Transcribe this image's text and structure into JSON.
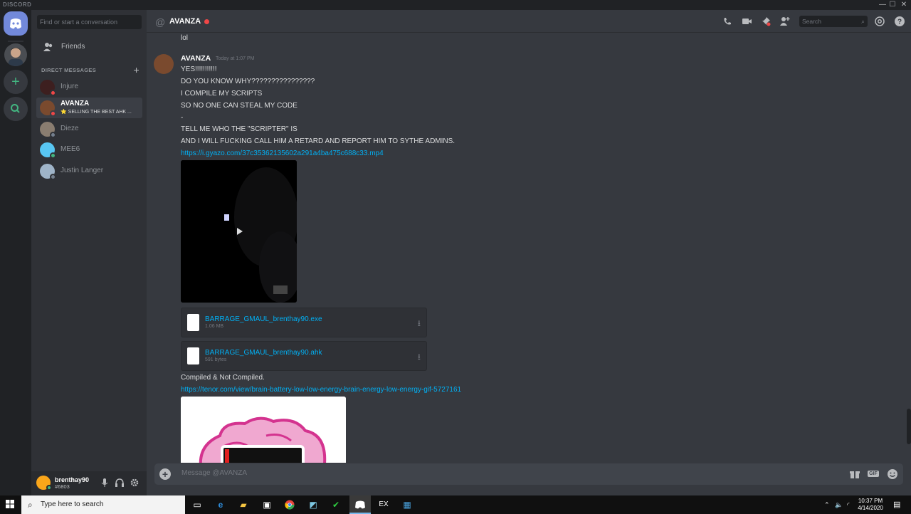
{
  "app": {
    "brand": "DISCORD"
  },
  "window_controls": {
    "minimize": "—",
    "maximize": "☐",
    "close": "✕"
  },
  "sidebar": {
    "search_placeholder": "Find or start a conversation",
    "friends_label": "Friends",
    "dm_header": "DIRECT MESSAGES",
    "dm_add": "+",
    "dms": [
      {
        "name": "Injure",
        "status": "dnd",
        "status_color": "#f04747"
      },
      {
        "name": "AVANZA",
        "sub": "⭐ SELLING THE BEST AHK ...",
        "status": "dnd",
        "status_color": "#f04747",
        "active": true
      },
      {
        "name": "Dieze",
        "status": "offline",
        "status_color": "#747f8d"
      },
      {
        "name": "MEE6",
        "status": "online",
        "status_color": "#43b581"
      },
      {
        "name": "Justin Langer",
        "status": "offline",
        "status_color": "#747f8d"
      }
    ],
    "user": {
      "name": "brenthay90",
      "tag": "#6803"
    }
  },
  "header": {
    "at_symbol": "@",
    "channel_name": "AVANZA",
    "search_placeholder": "Search",
    "icons": [
      "call-icon",
      "video-call-icon",
      "pin-icon",
      "add-friend-icon",
      "mention-icon",
      "help-icon"
    ]
  },
  "messages": {
    "prev_line": "lol",
    "author": "AVANZA",
    "timestamp": "Today at 1:07 PM",
    "lines": [
      "YES!!!!!!!!!!!",
      "DO YOU KNOW WHY????????????????",
      "I COMPILE MY SCRIPTS",
      "SO NO ONE CAN STEAL MY CODE",
      "-",
      "TELL ME WHO THE \"SCRIPTER\" IS",
      "AND I WILL FUCKING CALL HIM A RETARD AND REPORT HIM TO SYTHE ADMINS."
    ],
    "link1": "https://i.gyazo.com/37c35362135602a291a4ba475c688c33.mp4",
    "attachments": [
      {
        "name": "BARRAGE_GMAUL_brenthay90.exe",
        "size": "1.06 MB"
      },
      {
        "name": "BARRAGE_GMAUL_brenthay90.ahk",
        "size": "591 bytes"
      }
    ],
    "after_text": "Compiled & Not Compiled.",
    "link2": "https://tenor.com/view/brain-battery-low-low-energy-brain-energy-low-energy-gif-5727161"
  },
  "composer": {
    "placeholder": "Message @AVANZA",
    "gif_label": "GIF"
  },
  "taskbar": {
    "search_placeholder": "Type here to search",
    "ex_label": "EX",
    "time": "10:37 PM",
    "date": "4/14/2020"
  },
  "colors": {
    "accent": "#7289da",
    "link": "#00b0f4",
    "online": "#43b581",
    "dnd": "#f04747"
  }
}
